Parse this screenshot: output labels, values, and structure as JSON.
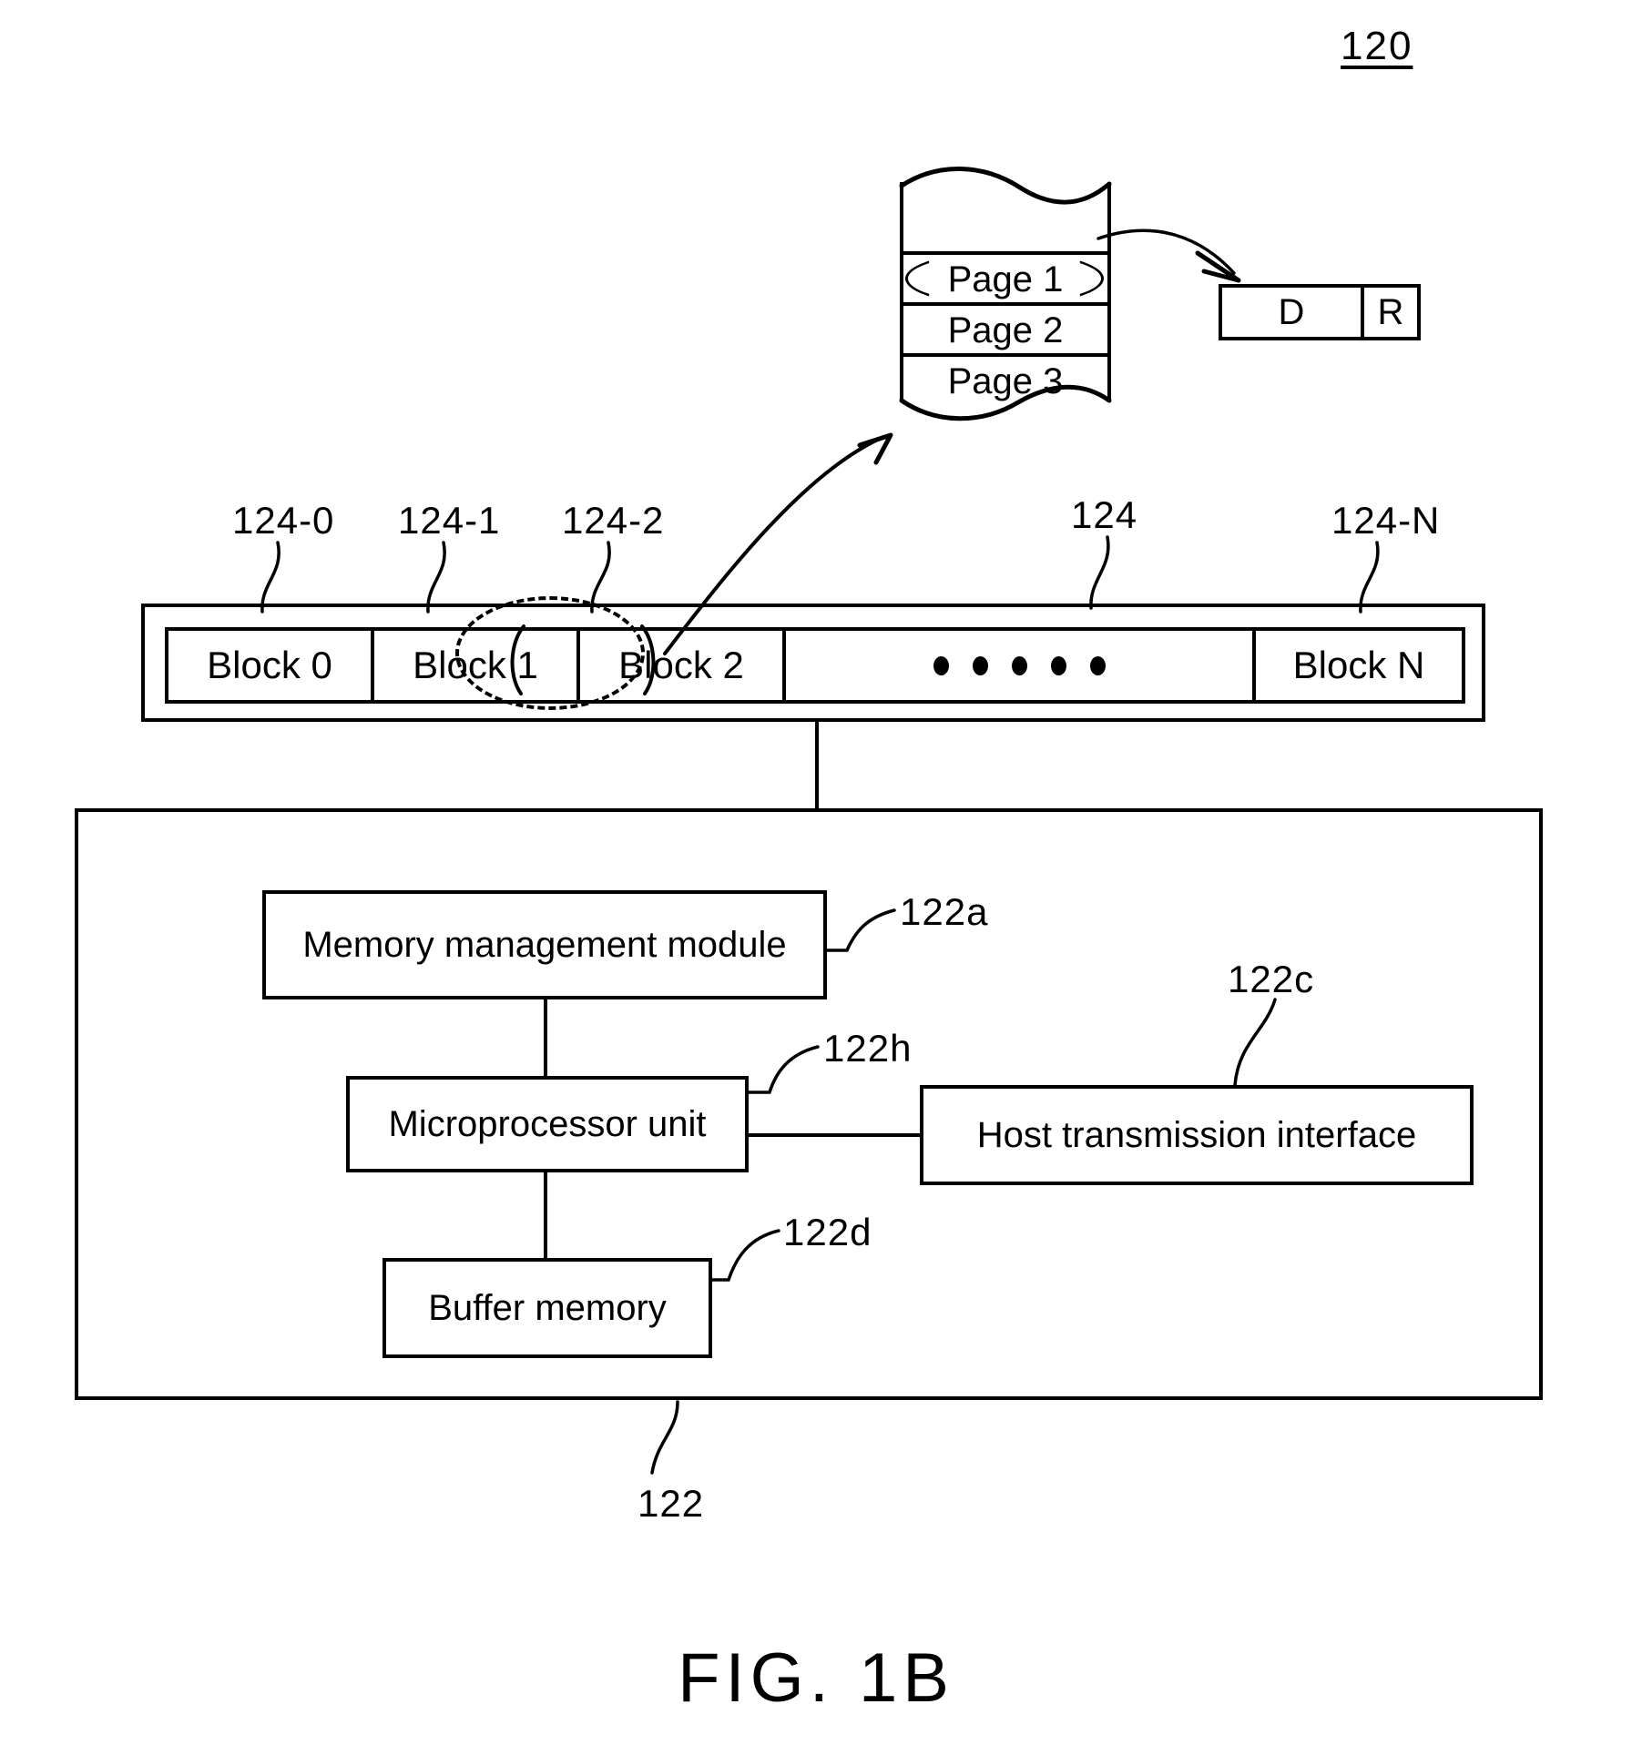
{
  "figure": {
    "caption": "FIG. 1B",
    "top_reference": "120"
  },
  "page_stack": {
    "reference": "124",
    "pages": [
      {
        "label": "Page 1",
        "highlighted": true
      },
      {
        "label": "Page 2",
        "highlighted": false
      },
      {
        "label": "Page 3",
        "highlighted": false
      }
    ]
  },
  "page_detail_box": {
    "data_area_label": "D",
    "redundancy_area_label": "R"
  },
  "blocks": {
    "container_reference": "124",
    "items": [
      {
        "label": "Block 0",
        "reference": "124-0"
      },
      {
        "label": "Block 1",
        "reference": "124-1"
      },
      {
        "label": "Block 2",
        "reference": "124-2",
        "highlighted": true
      },
      {
        "label": "Block N",
        "reference": "124-N"
      }
    ],
    "ellipsis_dots": 5
  },
  "controller": {
    "reference": "122",
    "modules": [
      {
        "label": "Memory management module",
        "reference": "122a"
      },
      {
        "label": "Microprocessor unit",
        "reference": "122h"
      },
      {
        "label": "Buffer memory",
        "reference": "122d"
      },
      {
        "label": "Host transmission interface",
        "reference": "122c"
      }
    ]
  }
}
